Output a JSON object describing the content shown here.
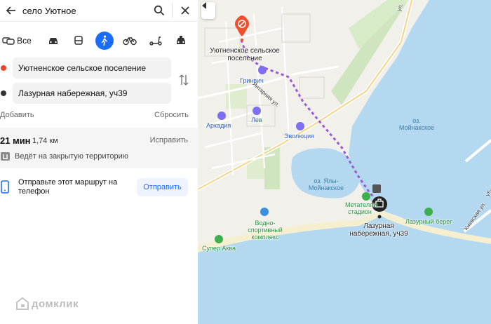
{
  "search": {
    "query": "село Уютное"
  },
  "modes": {
    "auto_label": "Все"
  },
  "route": {
    "from": "Уютненское сельское поселение",
    "to": "Лазурная набережная, уч39",
    "add_label": "Добавить",
    "reset_label": "Сбросить"
  },
  "info": {
    "time": "21 мин",
    "distance": "1,74 км",
    "fix_label": "Исправить",
    "warning": "Ведёт на закрытую территорию"
  },
  "send": {
    "text": "Отправьте этот маршрут на телефон",
    "button": "Отправить"
  },
  "watermark": "домклик",
  "map": {
    "labels": {
      "village": "Уютненское сельское поселение",
      "grinvich": "Гринвич",
      "arkadiya": "Аркадия",
      "lev": "Лев",
      "evolyutsiya": "Эволюция",
      "lake_moinak": "оз. Мойнакское",
      "lake_yaly": "оз. Ялы-Мойнакское",
      "stadium": "Метателли стадион",
      "destination": "Лазурная набережная, уч39",
      "lazurny_bereg": "Лазурный берег",
      "vodno": "Водно-спортивный комплекс",
      "super_akva": "Супер Аква",
      "street_yantar": "Янтарная ул.",
      "street_kiev": "Киевская ул.",
      "street_top": "ул.",
      "street_edge": "ул."
    },
    "colors": {
      "water": "#b4d8f0",
      "route": "#9b59d6",
      "pin": "#f04e2d",
      "accent": "#1a6dfa"
    }
  }
}
